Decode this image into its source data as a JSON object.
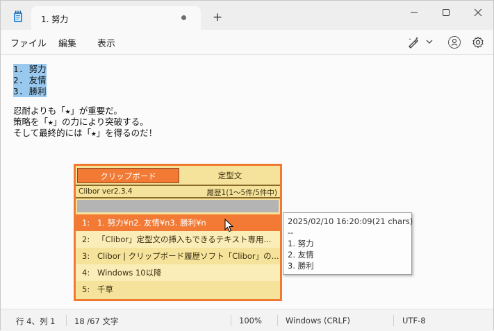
{
  "tab": {
    "title": "1. 努力"
  },
  "new_tab": "+",
  "menu": {
    "file": "ファイル",
    "edit": "編集",
    "view": "表示"
  },
  "editor": {
    "selected_lines": [
      "1. 努力",
      "2. 友情",
      "3. 勝利"
    ],
    "lines": [
      "忍耐よりも「★」が重要だ。",
      "策略を「★」の力により突破する。",
      "そして最終的には「★」を得るのだ！"
    ]
  },
  "clibor": {
    "tab_clipboard": "クリップボード",
    "tab_fixed": "定型文",
    "version": "Clibor ver2.3.4",
    "history": "履歴1(1～5件/5件中)",
    "items": [
      {
        "num": "1:",
        "text": "1. 努力¥n2. 友情¥n3. 勝利¥n"
      },
      {
        "num": "2:",
        "text": "「Clibor」定型文の挿入もできるテキスト専用..."
      },
      {
        "num": "3:",
        "text": "Clibor | クリップボード履歴ソフト「Clibor」の..."
      },
      {
        "num": "4:",
        "text": "Windows 10以降"
      },
      {
        "num": "5:",
        "text": "千草"
      }
    ],
    "accent_color": "#f27a34",
    "bg_color": "#f5e39b"
  },
  "tooltip": {
    "lines": [
      "2025/02/10 16:20:09(21 chars)",
      "--",
      "1. 努力",
      "2. 友情",
      "3. 勝利"
    ]
  },
  "status": {
    "position": "行 4、列 1",
    "count": "18 /67 文字",
    "zoom": "100%",
    "line_ending": "Windows (CRLF)",
    "encoding": "UTF-8"
  },
  "icons": {
    "app": "notepad-icon",
    "tab_modified": "unsaved-dot-icon",
    "copilot": "copilot-pen-icon",
    "account": "account-icon",
    "settings": "gear-icon",
    "cursor": "mouse-pointer-icon"
  }
}
